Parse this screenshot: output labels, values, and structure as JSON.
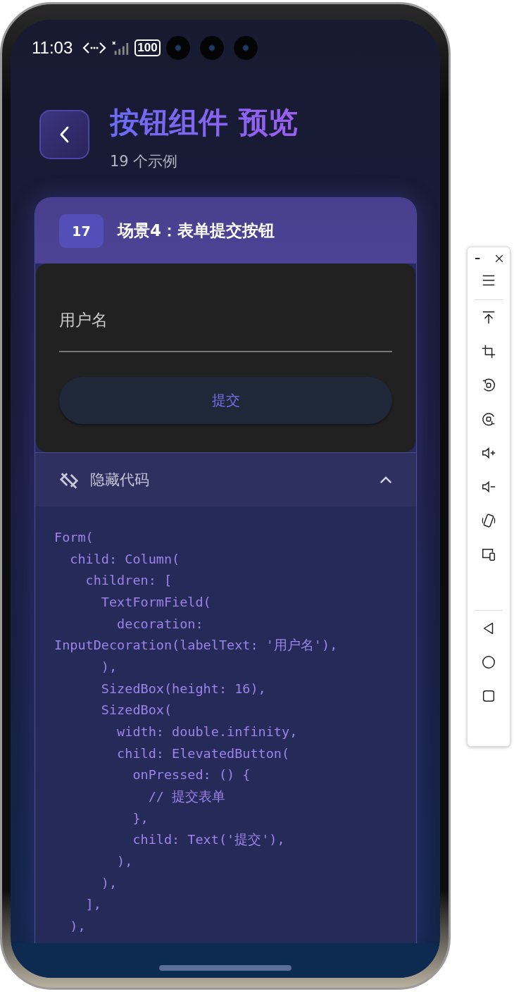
{
  "status_bar": {
    "time": "11:03",
    "battery": "100"
  },
  "header": {
    "title": "按钮组件 预览",
    "subtitle": "19 个示例"
  },
  "card": {
    "badge": "17",
    "title": "场景4：表单提交按钮",
    "preview": {
      "field": {
        "label": "用户名"
      },
      "button": "提交"
    },
    "code_toggle": {
      "label": "隐藏代码",
      "expanded": true
    },
    "code_lines": [
      "Form(",
      "  child: Column(",
      "    children: [",
      "      TextFormField(",
      "        decoration:",
      "InputDecoration(labelText: '用户名'),",
      "      ),",
      "      SizedBox(height: 16),",
      "      SizedBox(",
      "        width: double.infinity,",
      "        child: ElevatedButton(",
      "          onPressed: () {",
      "            // 提交表单",
      "          },",
      "          child: Text('提交'),",
      "        ),",
      "      ),",
      "    ],",
      "  ),"
    ]
  }
}
